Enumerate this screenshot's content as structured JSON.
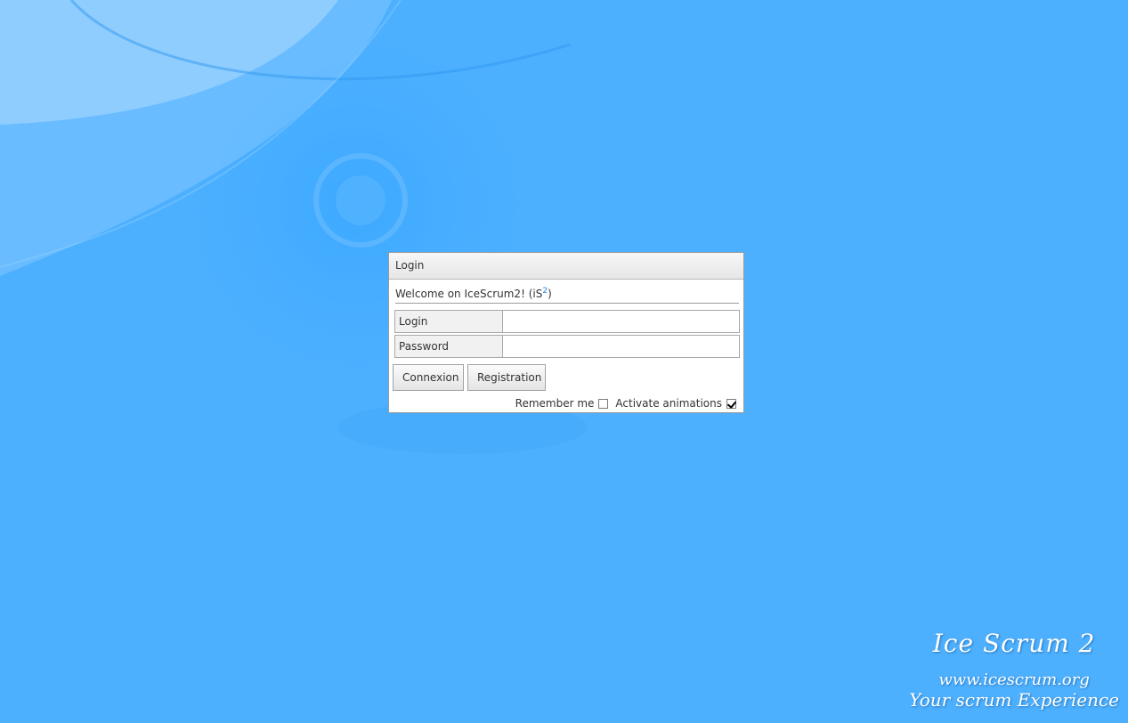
{
  "login_dialog": {
    "title": "Login",
    "welcome_text": "Welcome on IceScrum2! (iS",
    "welcome_sup": "2",
    "welcome_close": ")",
    "fields": [
      {
        "label": "Login",
        "value": ""
      },
      {
        "label": "Password",
        "value": ""
      }
    ],
    "connexion_label": "Connexion",
    "registration_label": "Registration",
    "remember_me_label": "Remember me",
    "remember_me_checked": false,
    "activate_animations_label": "Activate animations",
    "activate_animations_checked": true
  },
  "branding": {
    "title": "Ice Scrum 2",
    "url": "www.icescrum.org",
    "tagline": "Your scrum Experience"
  },
  "colors": {
    "background": "#4db0ff",
    "accent": "#1d84e0"
  }
}
